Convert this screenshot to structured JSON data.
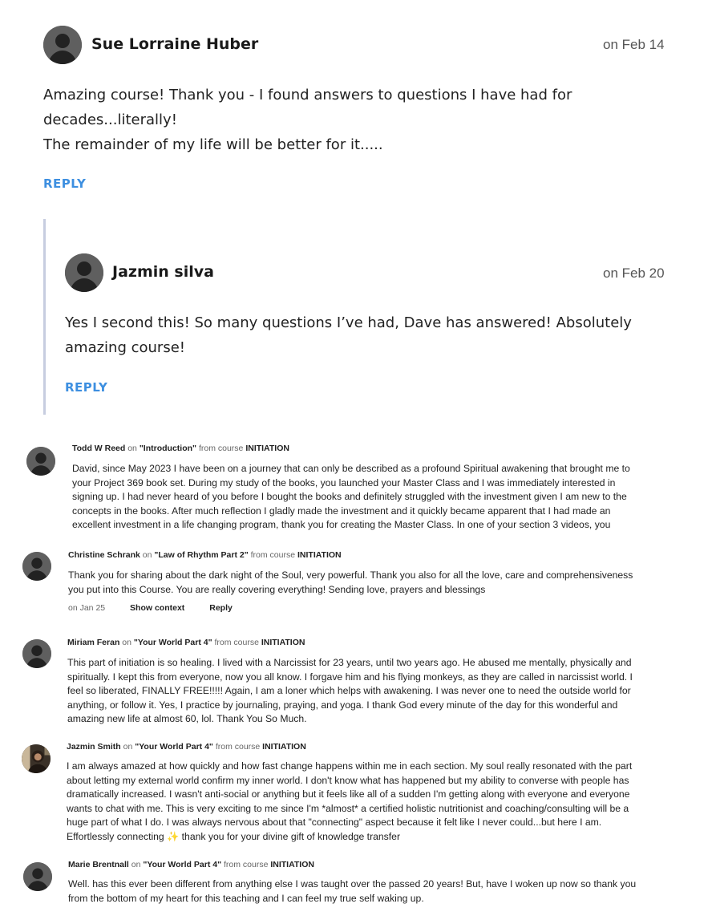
{
  "top_comments": [
    {
      "author": "Sue Lorraine Huber",
      "date": "on Feb 14",
      "lines": [
        "Amazing course! Thank you - I found answers to questions I have had for",
        "decades...literally!",
        "The remainder of my life will be better for it....."
      ],
      "reply_label": "REPLY"
    },
    {
      "author": "Jazmin silva",
      "date": "on Feb 20",
      "lines": [
        "Yes I second this! So many questions I’ve had, Dave has answered! Absolutely",
        "amazing course!"
      ],
      "reply_label": "REPLY"
    }
  ],
  "feed": [
    {
      "author": "Todd W Reed",
      "on_word": "on",
      "lesson": "\"Introduction\"",
      "from_text": "from course",
      "course": "INITIATION",
      "lines": [
        "David, since May 2023 I have been on a journey that can only be described as a profound Spiritual awakening that brought me to",
        "your Project 369 book set. During my study of the books, you launched your Master Class and I was immediately interested in",
        "signing up. I had never heard of you before I bought the books and definitely struggled with the investment given I am new to the",
        "concepts in the books. After much reflection I gladly made the investment and it quickly became apparent that I had made an",
        "excellent investment in a life changing program, thank you for creating the Master Class. In one of your section 3 videos, you"
      ]
    },
    {
      "author": "Christine Schrank",
      "on_word": "on",
      "lesson": "\"Law of Rhythm Part 2\"",
      "from_text": "from course",
      "course": "INITIATION",
      "lines": [
        "Thank you for sharing about the dark night of the Soul, very powerful. Thank you also for all the love, care and comprehensiveness",
        "you put into this Course. You are really covering everything! Sending love, prayers and blessings"
      ],
      "date": "on Jan 25",
      "show_context": "Show context",
      "reply": "Reply"
    },
    {
      "author": "Miriam Feran",
      "on_word": "on",
      "lesson": "\"Your World Part 4\"",
      "from_text": "from course",
      "course": "INITIATION",
      "lines": [
        "This part of initiation is so healing. I lived with a Narcissist for 23 years, until two years ago. He abused me mentally, physically and",
        "spiritually. I kept this from everyone, now you all know. I forgave him and his flying monkeys, as they are called in narcissist world. I",
        "feel so liberated, FINALLY FREE!!!!! Again, I am a loner which helps with awakening. I was never one to need the outside world for",
        "anything, or follow it. Yes, I practice by journaling, praying, and yoga. I thank God every minute of the day for this wonderful and",
        "amazing new life at almost 60, lol. Thank You So Much."
      ]
    },
    {
      "author": "Jazmin Smith",
      "on_word": "on",
      "lesson": "\"Your World Part 4\"",
      "from_text": "from course",
      "course": "INITIATION",
      "lines": [
        "I am always amazed at how quickly and how fast change happens within me in each section. My soul really resonated with the part",
        "about letting my external world confirm my inner world. I don't know what has happened but my ability to converse with people has",
        "dramatically increased. I wasn't anti-social or anything but it feels like all of a sudden I'm getting along with everyone and everyone",
        "wants to chat with me. This is very exciting to me since I'm *almost* a certified holistic nutritionist and coaching/consulting will be a",
        "huge part of what I do. I was always nervous about that \"connecting\" aspect because it felt like I never could...but here I am.",
        "Effortlessly connecting ✨ thank you for your divine gift of knowledge transfer"
      ]
    },
    {
      "author": "Marie Brentnall",
      "on_word": "on",
      "lesson": "\"Your World Part 4\"",
      "from_text": "from course",
      "course": "INITIATION",
      "lines": [
        "Well. has this ever been different from anything else I was taught over the passed 20 years! But, have I woken up now so thank you",
        "from the bottom of my heart for this teaching and I can feel my true self waking up."
      ]
    }
  ],
  "colors": {
    "reply_accent": "#3d8fe0",
    "thread_bar": "#c7cde0",
    "avatar_bg": "#5a5a5a"
  }
}
